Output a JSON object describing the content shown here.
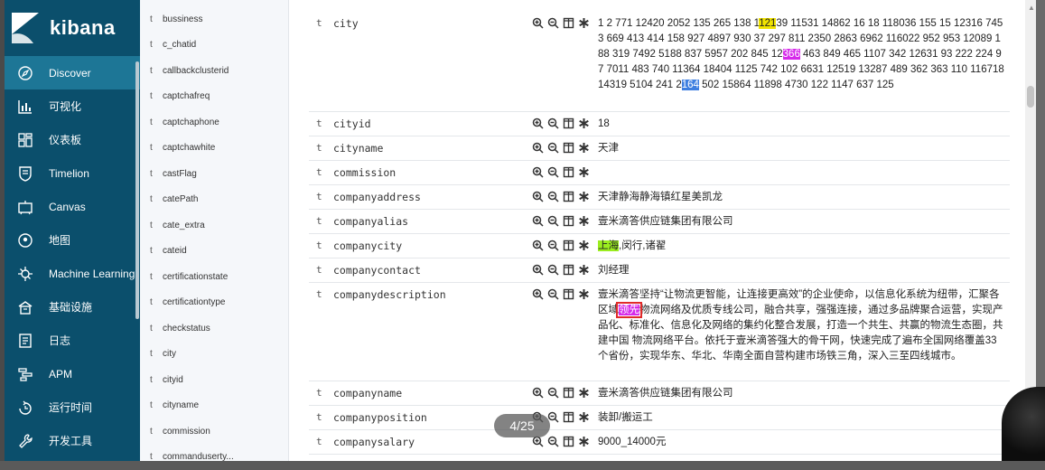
{
  "app": {
    "logo_text": "kibana"
  },
  "nav": {
    "items": [
      {
        "label": "Discover",
        "icon": "compass-icon",
        "active": true
      },
      {
        "label": "可视化",
        "icon": "bar-chart-icon"
      },
      {
        "label": "仪表板",
        "icon": "dashboard-icon"
      },
      {
        "label": "Timelion",
        "icon": "shield-icon"
      },
      {
        "label": "Canvas",
        "icon": "canvas-icon"
      },
      {
        "label": "地图",
        "icon": "map-pin-icon"
      },
      {
        "label": "Machine Learning",
        "icon": "ml-icon"
      },
      {
        "label": "基础设施",
        "icon": "infrastructure-icon"
      },
      {
        "label": "日志",
        "icon": "logs-icon"
      },
      {
        "label": "APM",
        "icon": "apm-icon"
      },
      {
        "label": "运行时间",
        "icon": "uptime-icon"
      },
      {
        "label": "开发工具",
        "icon": "wrench-icon"
      }
    ]
  },
  "field_list": {
    "type_label": "t",
    "items": [
      "bussiness",
      "c_chatid",
      "callbackclusterid",
      "captchafreq",
      "captchaphone",
      "captchawhite",
      "castFlag",
      "catePath",
      "cate_extra",
      "cateid",
      "certificationstate",
      "certificationtype",
      "checkstatus",
      "city",
      "cityid",
      "cityname",
      "commission",
      "commanduserty..."
    ]
  },
  "doc": {
    "type_label": "t",
    "rows": [
      {
        "name": "city",
        "value_parts": [
          {
            "t": "1 2 771 12420 2052 135 265 138 1"
          },
          {
            "t": "121",
            "hl": "y"
          },
          {
            "t": "39 11531 14862 16 18 118036 155 15 12316 7453 669 413 414 158 927 4897 930 37 297 811 2350 2863 6962 116022 952 953 12089 188 319 7492 5188 837 5957 202 845 12"
          },
          {
            "t": "366",
            "hl": "m"
          },
          {
            "t": " 463 849 465 1107 342 12631 93 222 224 97 7011 483 740 11364 18404 1125 742 102 6631 12519 13287 489 362 363 110 116718 14319 5104 241 2"
          },
          {
            "t": "164",
            "hl": "b"
          },
          {
            "t": " 502 15864 11898 4730 122 1147 637 125"
          }
        ]
      },
      {
        "name": "cityid",
        "value_parts": [
          {
            "t": "18"
          }
        ]
      },
      {
        "name": "cityname",
        "value_parts": [
          {
            "t": "天津"
          }
        ]
      },
      {
        "name": "commission",
        "value_parts": [
          {
            "t": ""
          }
        ]
      },
      {
        "name": "companyaddress",
        "value_parts": [
          {
            "t": "天津静海静海镇红星美凯龙"
          }
        ]
      },
      {
        "name": "companyalias",
        "value_parts": [
          {
            "t": "壹米滴答供应链集团有限公司"
          }
        ]
      },
      {
        "name": "companycity",
        "value_parts": [
          {
            "t": "上海",
            "hl": "g"
          },
          {
            "t": ",闵行,诸翟"
          }
        ]
      },
      {
        "name": "companycontact",
        "value_parts": [
          {
            "t": "刘经理"
          }
        ]
      },
      {
        "name": "companydescription",
        "value_parts": [
          {
            "t": "壹米滴答坚持“让物流更智能，让连接更高效”的企业使命，以信息化系统为纽带，汇聚各区域"
          },
          {
            "t": "领先",
            "hl": "m",
            "boxed": true
          },
          {
            "t": "物流网络及优质专线公司，融合共享，强强连接，通过多品牌聚合运营，实现产品化、标准化、信息化及网络的集约化整合发展，打造一个共生、共赢的物流生态圈，共建中国 物流网络平台。依托于壹米滴答强大的骨干网，快速完成了遍布全国网络覆盖33个省份，实现华东、华北、华南全面自营构建市场铁三角，深入三至四线城市。"
          }
        ]
      },
      {
        "name": "companyname",
        "value_parts": [
          {
            "t": "壹米滴答供应链集团有限公司"
          }
        ]
      },
      {
        "name": "companyposition",
        "value_parts": [
          {
            "t": "装卸/搬运工"
          }
        ]
      },
      {
        "name": "companysalary",
        "value_parts": [
          {
            "t": "9000_14000元"
          }
        ]
      }
    ]
  },
  "pager": {
    "text": "4/25"
  }
}
